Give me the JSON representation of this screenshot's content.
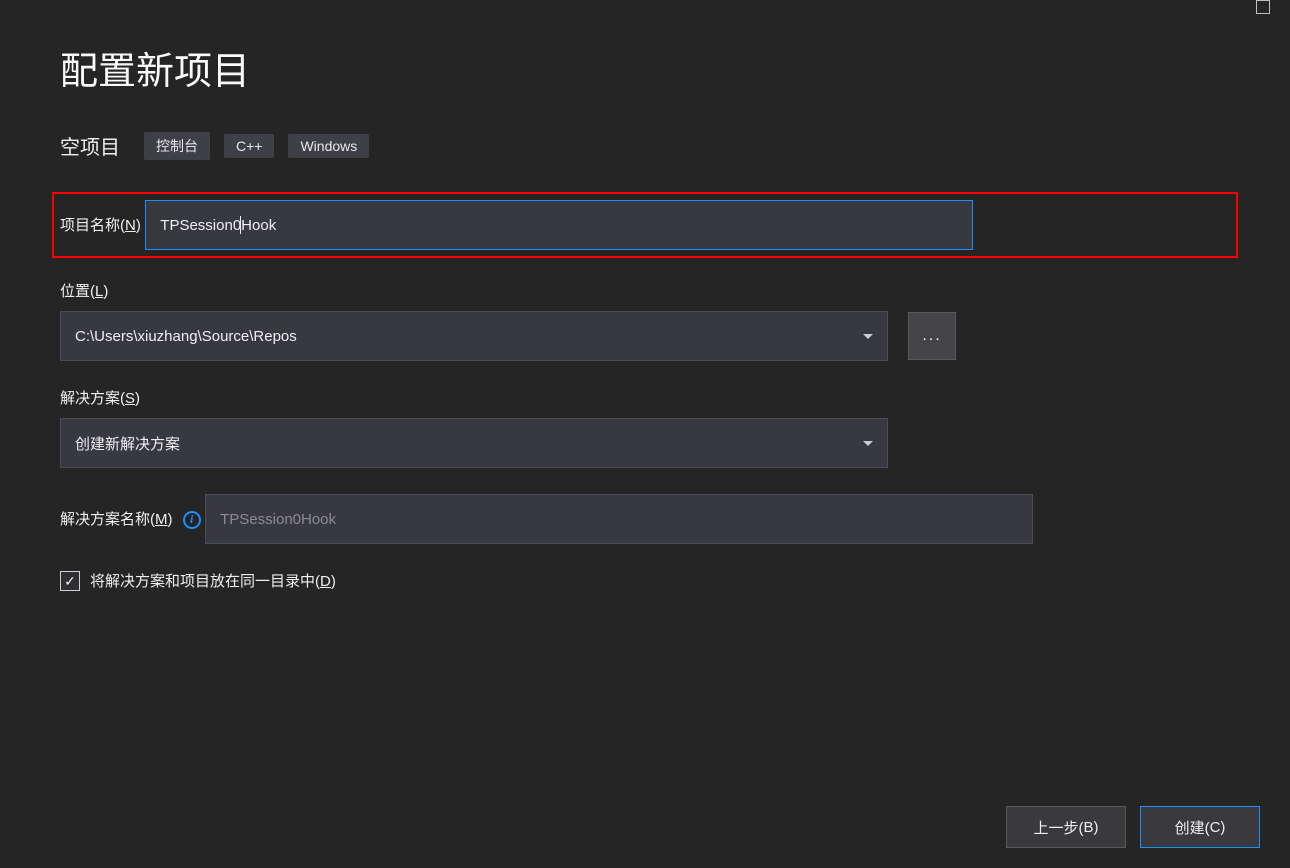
{
  "header": {
    "title": "配置新项目",
    "subtitle": "空项目",
    "tags": [
      "控制台",
      "C++",
      "Windows"
    ]
  },
  "project_name": {
    "label_prefix": "项目名称(",
    "label_key": "N",
    "label_suffix": ")",
    "value_before_cursor": "TPSession0",
    "value_after_cursor": "Hook"
  },
  "location": {
    "label_prefix": "位置(",
    "label_key": "L",
    "label_suffix": ")",
    "value": "C:\\Users\\xiuzhang\\Source\\Repos",
    "browse_label": "..."
  },
  "solution": {
    "label_prefix": "解决方案(",
    "label_key": "S",
    "label_suffix": ")",
    "value": "创建新解决方案"
  },
  "solution_name": {
    "label_prefix": "解决方案名称(",
    "label_key": "M",
    "label_suffix": ")",
    "placeholder": "TPSession0Hook"
  },
  "same_dir": {
    "checked": true,
    "label_prefix": "将解决方案和项目放在同一目录中(",
    "label_key": "D",
    "label_suffix": ")"
  },
  "buttons": {
    "back_prefix": "上一步(",
    "back_key": "B",
    "back_suffix": ")",
    "create_prefix": "创建(",
    "create_key": "C",
    "create_suffix": ")"
  }
}
